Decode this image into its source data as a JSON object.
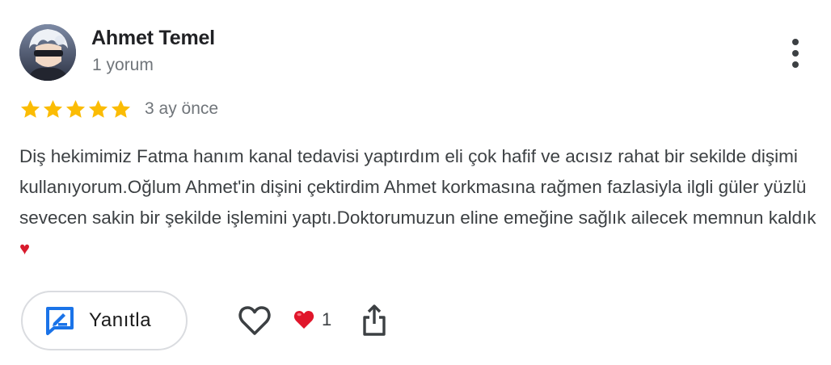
{
  "review": {
    "author": {
      "name": "Ahmet Temel",
      "meta": "1 yorum",
      "avatar_icon": "avatar-image"
    },
    "rating": 5,
    "rating_max": 5,
    "star_color": "#fbbc04",
    "date": "3 ay önce",
    "text": "Diş hekimimiz Fatma hanım kanal tedavisi yaptırdım eli çok hafif ve acısız rahat bir sekilde dişimi kullanıyorum.Oğlum Ahmet'in dişini çektirdim Ahmet korkmasına rağmen fazlasiyla ilgli güler yüzlü sevecen sakin bir şekilde işlemini yaptı.Doktorumuzun eline emeğine sağlık ailecek memnun kaldık",
    "text_emoji": "♥",
    "more_icon": "more-vert-icon"
  },
  "actions": {
    "reply_label": "Yanıtla",
    "reply_icon": "reply-icon",
    "like_icon": "heart-outline-icon",
    "reaction_icon": "red-heart-icon",
    "reaction_count": "1",
    "share_icon": "share-icon",
    "accent_color": "#1a73e8"
  }
}
